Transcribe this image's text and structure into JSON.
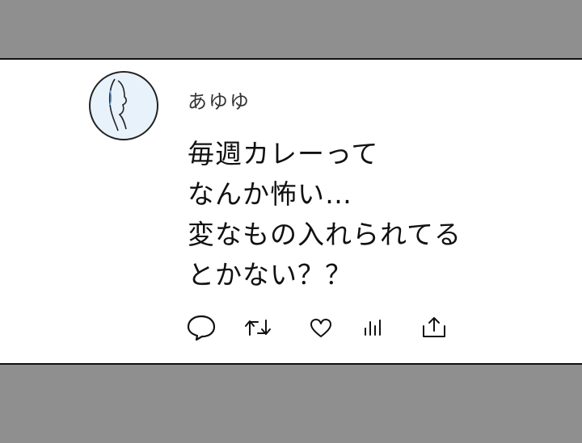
{
  "post": {
    "username": "あゆゆ",
    "lines": [
      "毎週カレーって",
      "なんか怖い…",
      "変なもの入れられてる",
      "とかない？？"
    ]
  },
  "actions": {
    "icons": [
      "reply-icon",
      "retweet-icon",
      "like-icon",
      "views-icon",
      "share-icon"
    ]
  },
  "colors": {
    "frame_gray": "#8f8f8f",
    "avatar_fill": "#e8f2fb",
    "text": "#111111"
  }
}
